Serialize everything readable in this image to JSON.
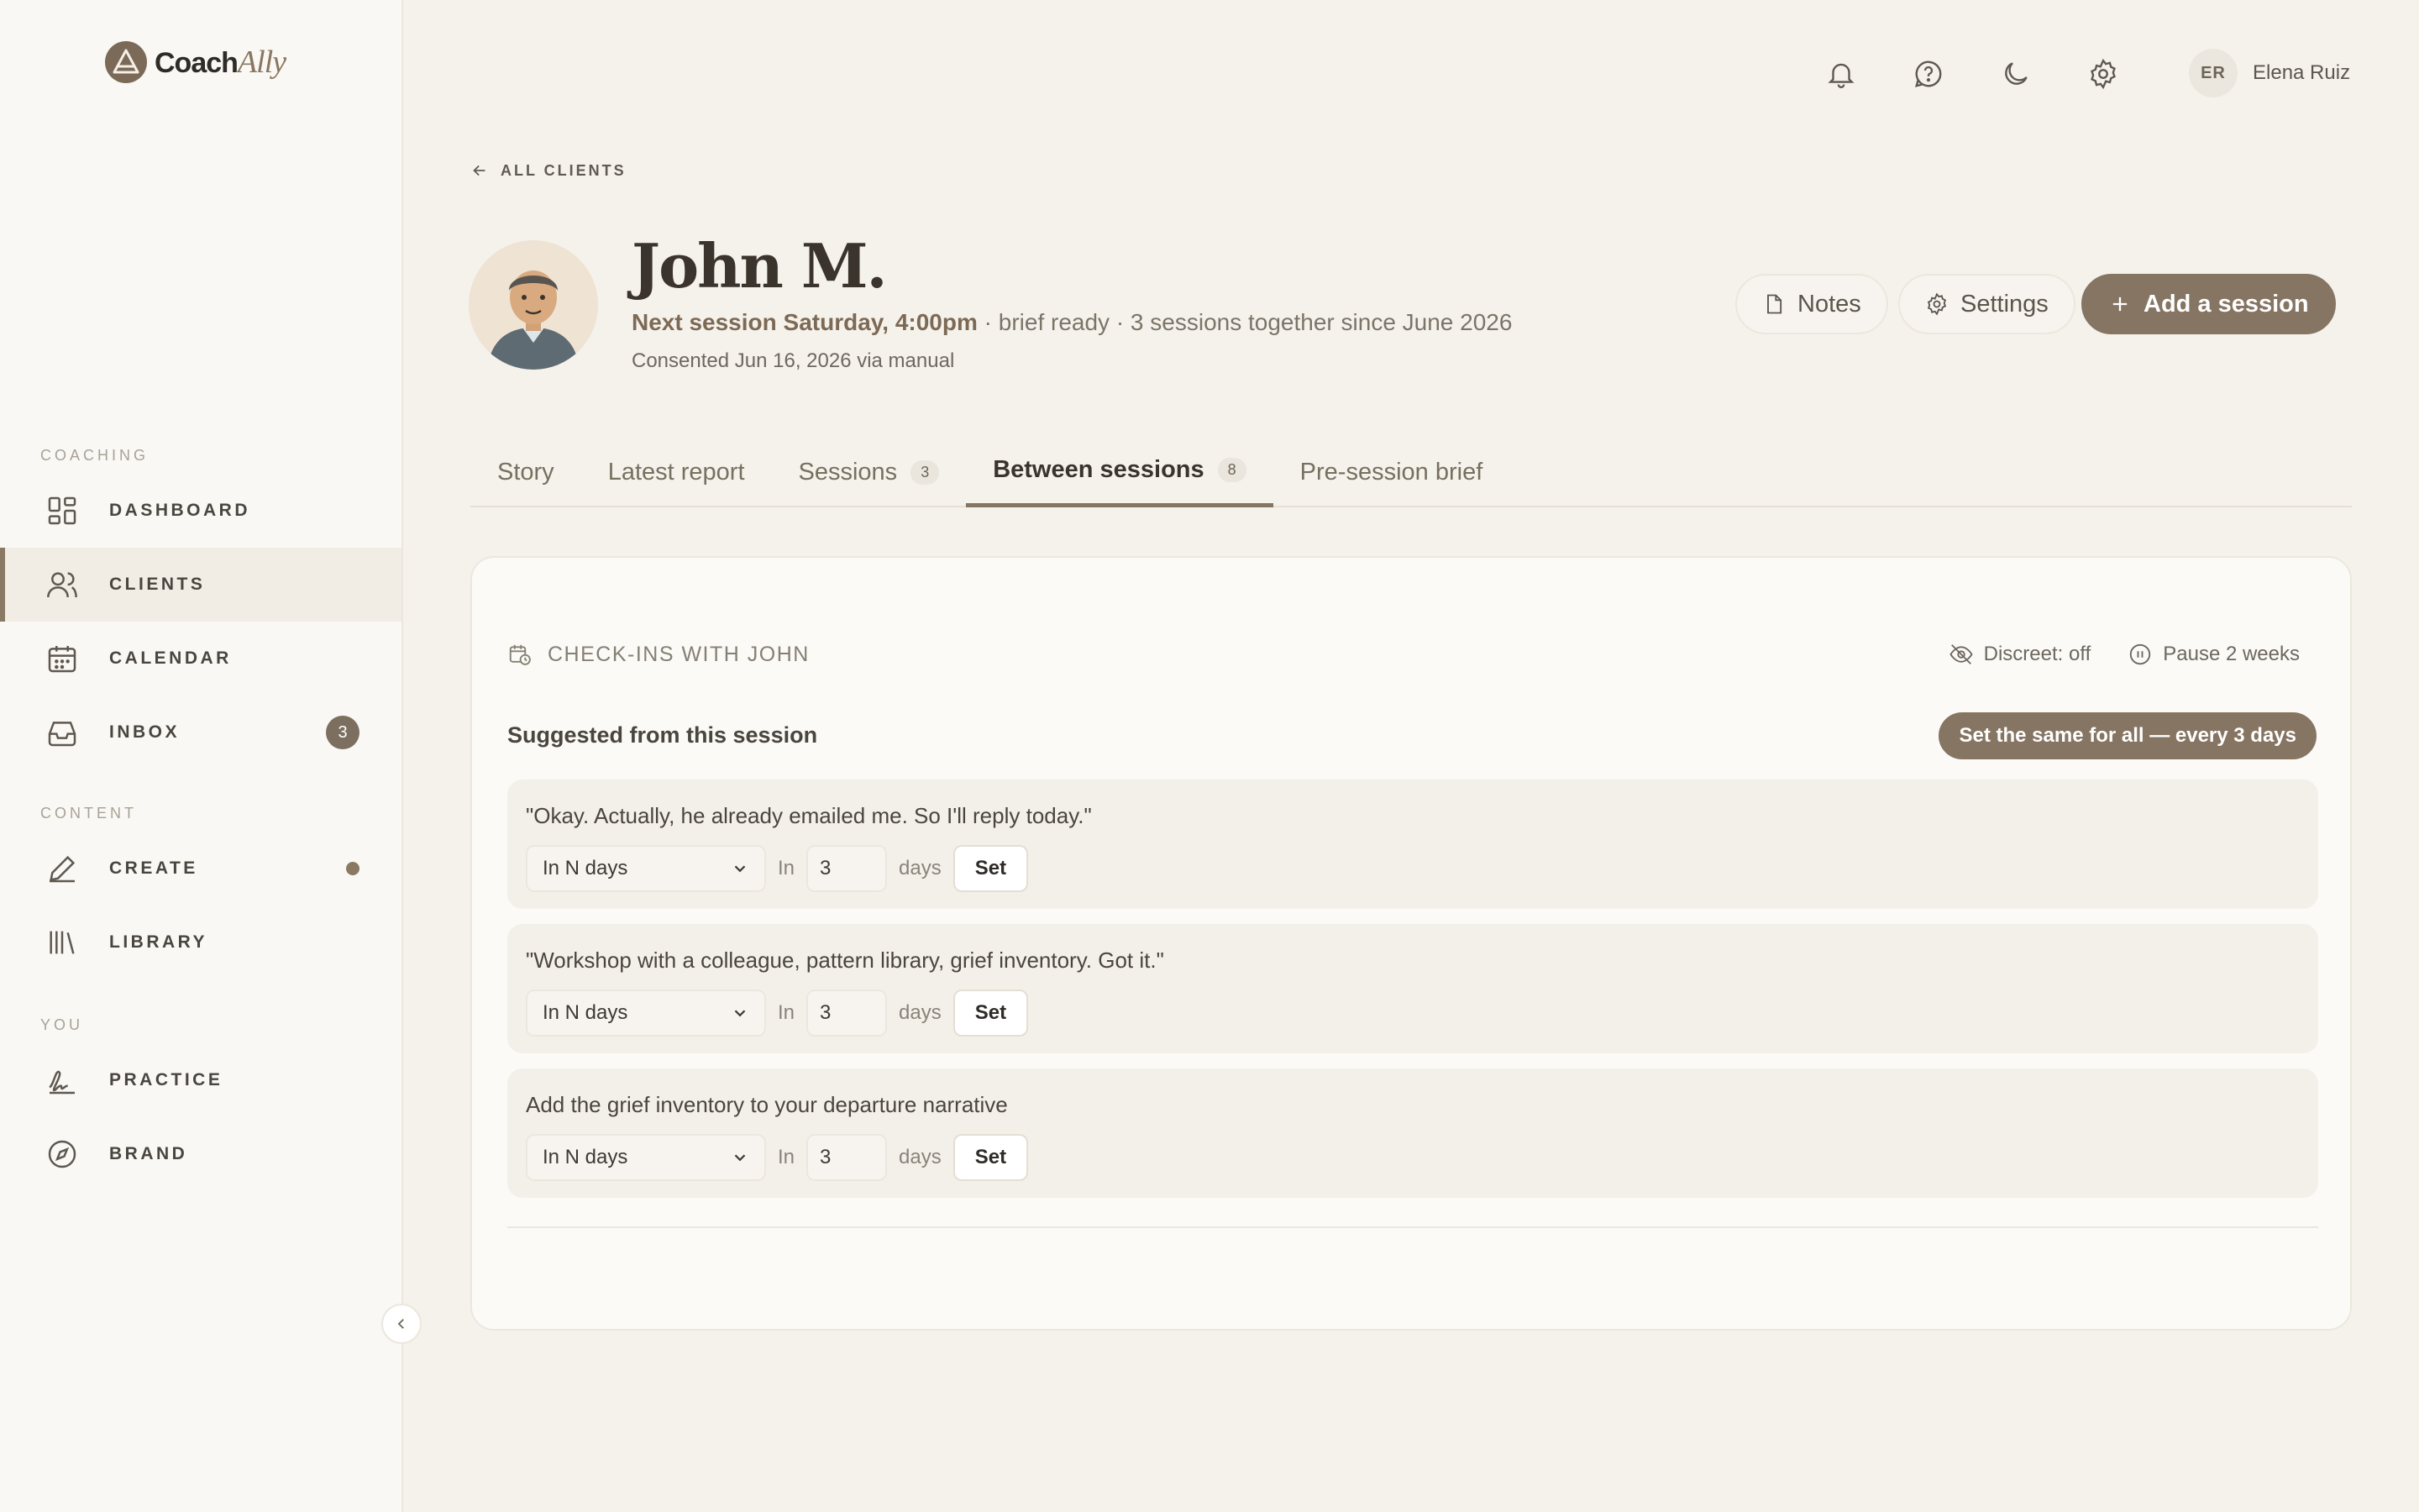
{
  "brand": {
    "name_main": "Coach",
    "name_accent": "Ally"
  },
  "sidebar": {
    "sections": [
      {
        "label": "COACHING"
      },
      {
        "label": "CONTENT"
      },
      {
        "label": "YOU"
      }
    ],
    "items": [
      {
        "label": "DASHBOARD",
        "icon": "dashboard-icon"
      },
      {
        "label": "CLIENTS",
        "icon": "users-icon",
        "active": true
      },
      {
        "label": "CALENDAR",
        "icon": "calendar-icon"
      },
      {
        "label": "INBOX",
        "icon": "inbox-icon",
        "badge": "3"
      },
      {
        "label": "CREATE",
        "icon": "pen-icon",
        "dot": true
      },
      {
        "label": "LIBRARY",
        "icon": "library-icon"
      },
      {
        "label": "PRACTICE",
        "icon": "signature-icon"
      },
      {
        "label": "BRAND",
        "icon": "compass-icon"
      }
    ]
  },
  "topbar": {
    "icons": [
      "bell-icon",
      "help-icon",
      "moon-icon",
      "gear-icon"
    ],
    "user": {
      "initials": "ER",
      "name": "Elena Ruiz"
    }
  },
  "back_link": "ALL CLIENTS",
  "client": {
    "name": "John M.",
    "next_session": "Next session Saturday, 4:00pm",
    "meta_rest": " · brief ready · 3 sessions together since June 2026",
    "consent": "Consented Jun 16, 2026 via manual"
  },
  "header_buttons": {
    "notes": "Notes",
    "settings": "Settings",
    "add_session": "Add a session"
  },
  "tabs": [
    {
      "label": "Story"
    },
    {
      "label": "Latest report"
    },
    {
      "label": "Sessions",
      "badge": "3"
    },
    {
      "label": "Between sessions",
      "badge": "8",
      "active": true
    },
    {
      "label": "Pre-session brief"
    }
  ],
  "checkins": {
    "heading": "CHECK-INS WITH JOHN",
    "discreet": "Discreet: off",
    "pause": "Pause 2 weeks",
    "suggested_title": "Suggested from this session",
    "set_all": "Set the same for all — every 3 days",
    "row_in_label": "In",
    "row_days_label": "days",
    "set_label": "Set",
    "suggestions": [
      {
        "text": "\"Okay. Actually, he already emailed me. So I'll reply today.\"",
        "mode": "In N days",
        "days": "3"
      },
      {
        "text": "\"Workshop with a colleague, pattern library, grief inventory. Got it.\"",
        "mode": "In N days",
        "days": "3"
      },
      {
        "text": "Add the grief inventory to your departure narrative",
        "mode": "In N days",
        "days": "3"
      }
    ]
  },
  "colors": {
    "accent": "#857562",
    "background": "#f5f2ec",
    "sidebar": "#faf8f4"
  }
}
